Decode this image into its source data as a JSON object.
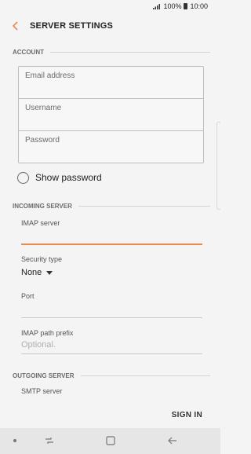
{
  "status": {
    "text": "100% ▮ 10:00",
    "battery": "100%",
    "time": "10:00"
  },
  "header": {
    "title": "SERVER SETTINGS"
  },
  "account": {
    "label": "ACCOUNT",
    "email_placeholder": "Email address",
    "username_placeholder": "Username",
    "password_placeholder": "Password"
  },
  "show_password": {
    "label": "Show password",
    "checked": false
  },
  "incoming": {
    "label": "INCOMING SERVER",
    "imap_label": "IMAP server",
    "security_label": "Security type",
    "security_value": "None",
    "port_label": "Port",
    "path_prefix_label": "IMAP path prefix",
    "path_prefix_placeholder": "Optional."
  },
  "outgoing": {
    "label": "OUTGOING SERVER",
    "smtp_label": "SMTP server"
  },
  "actions": {
    "sign_in": "SIGN IN"
  },
  "colors": {
    "accent": "#e98b4e",
    "background": "#f4f4f4",
    "navbar": "#e6e6e6"
  },
  "icons": [
    "signal-icon",
    "battery-icon",
    "back-arrow-icon",
    "radio-icon",
    "caret-down-icon",
    "recent-apps-icon",
    "home-icon",
    "nav-back-icon"
  ]
}
